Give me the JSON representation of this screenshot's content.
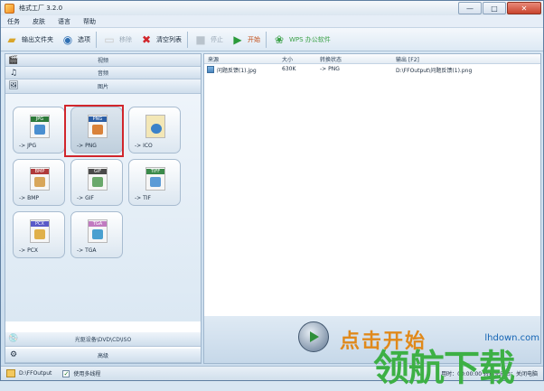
{
  "window": {
    "title": "格式工厂 3.2.0",
    "buttons": [
      "—",
      "□",
      "✕"
    ]
  },
  "menu": [
    "任务",
    "皮肤",
    "语言",
    "帮助"
  ],
  "toolbar": {
    "output_folder": "输出文件夹",
    "options": "选项",
    "remove": "移除",
    "clear_list": "清空列表",
    "stop": "停止",
    "start": "开始",
    "wps": "WPS 办公软件"
  },
  "categories": {
    "video": "视频",
    "audio": "音频",
    "image": "图片",
    "rom": "光驱设备\\DVD\\CD\\ISO",
    "advanced": "高级"
  },
  "tiles": [
    {
      "tag": "JPG",
      "label": "-> JPG",
      "tag_color": "#2c7a3a",
      "pic_color": "#4b8fd0"
    },
    {
      "tag": "PNG",
      "label": "-> PNG",
      "tag_color": "#2b5ea6",
      "pic_color": "#d9823a"
    },
    {
      "tag": "",
      "label": "-> ICO",
      "tag_color": "#e0c05a",
      "pic_color": "#3b82c9"
    },
    {
      "tag": "BMP",
      "label": "-> BMP",
      "tag_color": "#b03a3a",
      "pic_color": "#d8a65a"
    },
    {
      "tag": "GIF",
      "label": "-> GIF",
      "tag_color": "#4a4a4a",
      "pic_color": "#6aa86b"
    },
    {
      "tag": "TIFF",
      "label": "-> TIF",
      "tag_color": "#3a8a4a",
      "pic_color": "#5b9bd6"
    },
    {
      "tag": "PCX",
      "label": "-> PCX",
      "tag_color": "#5a5ac8",
      "pic_color": "#e0b04a"
    },
    {
      "tag": "TGA",
      "label": "-> TGA",
      "tag_color": "#c07ac0",
      "pic_color": "#4aa0d0"
    }
  ],
  "list": {
    "headers": {
      "source": "来源",
      "size": "大小",
      "status": "转换状态",
      "output": "输出 [F2]"
    },
    "rows": [
      {
        "source": "问题反馈(1).jpg",
        "size": "630K",
        "status": "-> PNG",
        "output": "D:\\FFOutput\\问题反馈(1).png"
      }
    ]
  },
  "start_panel": {
    "text": "点击开始"
  },
  "status": {
    "output_path": "D:\\FFOutput",
    "multithread_label": "使用多线程",
    "multithread_checked": "✓",
    "right_text": "用时：00:00:00    转换完成后：关闭电脑"
  },
  "watermark": {
    "url": "lhdown.com",
    "text": "领航下载"
  }
}
